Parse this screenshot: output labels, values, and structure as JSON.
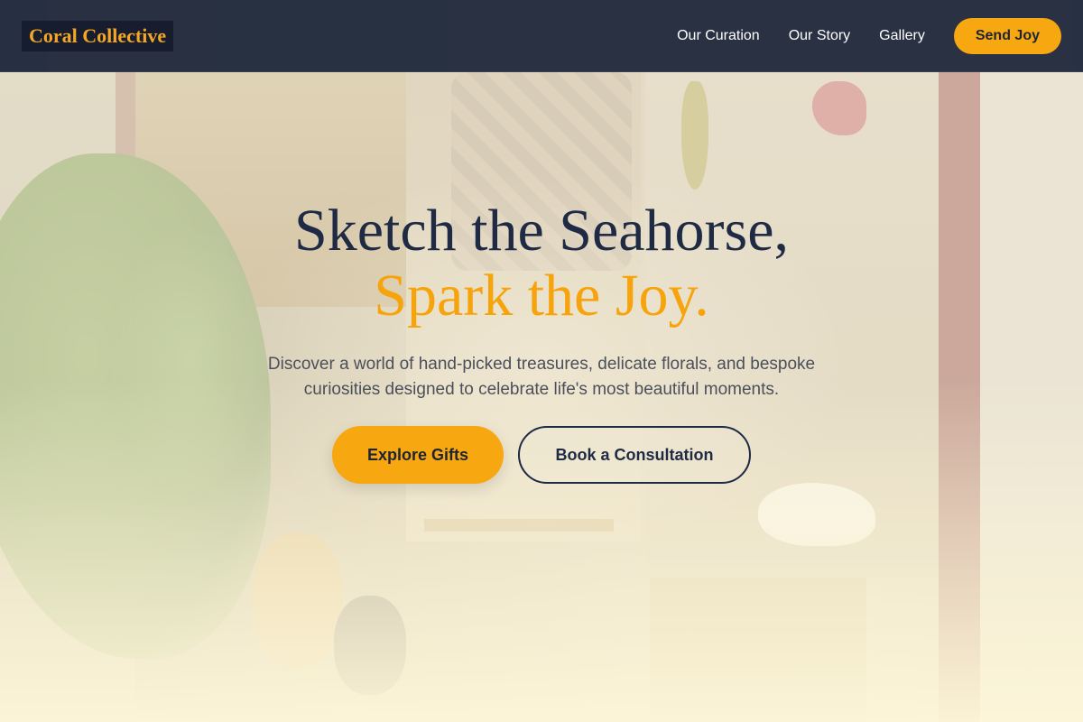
{
  "brand": {
    "name": "Coral Collective"
  },
  "nav": {
    "links": [
      "Our Curation",
      "Our Story",
      "Gallery"
    ],
    "cta_label": "Send Joy"
  },
  "hero": {
    "headline_line1": "Sketch the Seahorse,",
    "headline_line2": "Spark the Joy.",
    "subtext": "Discover a world of hand-picked treasures, delicate florals, and bespoke curiosities designed to celebrate life's most beautiful moments.",
    "primary_button": "Explore Gifts",
    "secondary_button": "Book a Consultation",
    "background": "shop-window-photo"
  },
  "colors": {
    "accent": "#f7a710",
    "nav_background": "#1d263a",
    "headline": "#1f2a44"
  }
}
